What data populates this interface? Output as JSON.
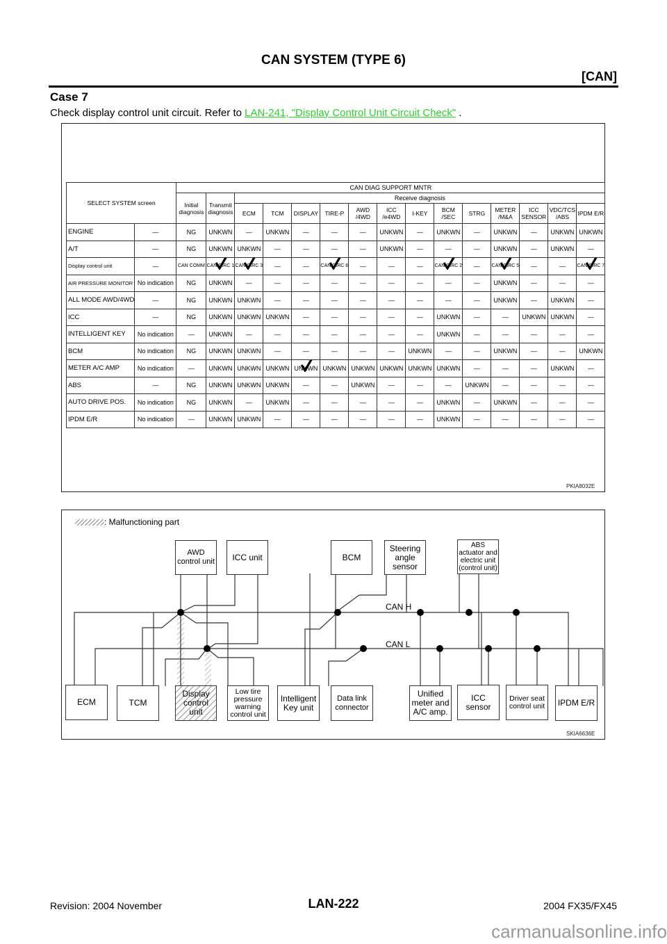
{
  "header": {
    "title": "CAN SYSTEM (TYPE 6)",
    "section": "[CAN]"
  },
  "case": {
    "title": "Case 7",
    "text": "Check display control unit circuit. Refer to ",
    "link": "LAN-241, \"Display Control Unit Circuit Check\"",
    "suffix": " ."
  },
  "table": {
    "select_header": "SELECT SYSTEM screen",
    "mntr_header": "CAN DIAG SUPPORT MNTR",
    "initial_header": "Initial diagnosis",
    "transmit_header": "Transmit diagnosis",
    "receive_header": "Receive diagnosis",
    "receive_columns": [
      "ECM",
      "TCM",
      "DISPLAY",
      "TIRE-P",
      "AWD /4WD",
      "ICC /e4WD",
      "I-KEY",
      "BCM /SEC",
      "STRG",
      "METER /M&A",
      "ICC SENSOR",
      "VDC/TCS /ABS",
      "IPDM E/R"
    ],
    "rows": [
      {
        "system": "ENGINE",
        "select": "—",
        "initial": "NG",
        "transmit": "UNKWN",
        "receive": [
          "—",
          "UNKWN",
          "—",
          "—",
          "—",
          "UNKWN",
          "—",
          "UNKWN",
          "—",
          "UNKWN",
          "—",
          "UNKWN",
          "UNKWN"
        ]
      },
      {
        "system": "A/T",
        "select": "—",
        "initial": "NG",
        "transmit": "UNKWN",
        "receive": [
          "UNKWN",
          "—",
          "—",
          "—",
          "—",
          "UNKWN",
          "—",
          "—",
          "—",
          "UNKWN",
          "—",
          "UNKWN",
          "—"
        ]
      },
      {
        "system": "Display control unit",
        "select": "—",
        "initial": "CAN COMM",
        "transmit": "CAN CIRC 1",
        "receive": [
          "CAN CIRC 3",
          "—",
          "—",
          "CAN CIRC 6",
          "—",
          "—",
          "—",
          "CAN CIRC 2",
          "—",
          "CAN CIRC 5",
          "—",
          "—",
          "CAN CIRC 7"
        ]
      },
      {
        "system": "AIR PRESSURE MONITOR",
        "select": "No indication",
        "initial": "NG",
        "transmit": "UNKWN",
        "receive": [
          "—",
          "—",
          "—",
          "—",
          "—",
          "—",
          "—",
          "—",
          "—",
          "UNKWN",
          "—",
          "—",
          "—"
        ]
      },
      {
        "system": "ALL MODE AWD/4WD",
        "select": "—",
        "initial": "NG",
        "transmit": "UNKWN",
        "receive": [
          "UNKWN",
          "—",
          "—",
          "—",
          "—",
          "—",
          "—",
          "—",
          "—",
          "UNKWN",
          "—",
          "UNKWN",
          "—"
        ]
      },
      {
        "system": "ICC",
        "select": "—",
        "initial": "NG",
        "transmit": "UNKWN",
        "receive": [
          "UNKWN",
          "UNKWN",
          "—",
          "—",
          "—",
          "—",
          "—",
          "UNKWN",
          "—",
          "—",
          "UNKWN",
          "UNKWN",
          "—"
        ]
      },
      {
        "system": "INTELLIGENT KEY",
        "select": "No indication",
        "initial": "—",
        "transmit": "UNKWN",
        "receive": [
          "—",
          "—",
          "—",
          "—",
          "—",
          "—",
          "—",
          "UNKWN",
          "—",
          "—",
          "—",
          "—",
          "—"
        ]
      },
      {
        "system": "BCM",
        "select": "No indication",
        "initial": "NG",
        "transmit": "UNKWN",
        "receive": [
          "UNKWN",
          "—",
          "—",
          "—",
          "—",
          "—",
          "UNKWN",
          "—",
          "—",
          "UNKWN",
          "—",
          "—",
          "UNKWN"
        ]
      },
      {
        "system": "METER A/C AMP",
        "select": "No indication",
        "initial": "—",
        "transmit": "UNKWN",
        "receive": [
          "UNKWN",
          "UNKWN",
          "UNKWN",
          "UNKWN",
          "UNKWN",
          "UNKWN",
          "UNKWN",
          "UNKWN",
          "—",
          "—",
          "—",
          "UNKWN",
          "—"
        ]
      },
      {
        "system": "ABS",
        "select": "—",
        "initial": "NG",
        "transmit": "UNKWN",
        "receive": [
          "UNKWN",
          "UNKWN",
          "—",
          "—",
          "UNKWN",
          "—",
          "—",
          "—",
          "UNKWN",
          "—",
          "—",
          "—",
          "—"
        ]
      },
      {
        "system": "AUTO DRIVE POS.",
        "select": "No indication",
        "initial": "NG",
        "transmit": "UNKWN",
        "receive": [
          "—",
          "UNKWN",
          "—",
          "—",
          "—",
          "—",
          "—",
          "UNKWN",
          "—",
          "UNKWN",
          "—",
          "—",
          "—"
        ]
      },
      {
        "system": "IPDM E/R",
        "select": "No indication",
        "initial": "—",
        "transmit": "UNKWN",
        "receive": [
          "UNKWN",
          "—",
          "—",
          "—",
          "—",
          "—",
          "—",
          "UNKWN",
          "—",
          "—",
          "—",
          "—",
          "—"
        ]
      }
    ],
    "checked_cells": [
      "2-transmit",
      "2-r0",
      "2-r3",
      "2-r7",
      "2-r9",
      "2-r12",
      "8-r2"
    ],
    "figure_id": "PKIA8032E"
  },
  "wiring": {
    "legend": ": Malfunctioning part",
    "can_h": "CAN H",
    "can_l": "CAN L",
    "top_units": [
      "AWD control unit",
      "ICC unit",
      "BCM",
      "Steering angle sensor",
      "ABS actuator and electric unit (control unit)"
    ],
    "bottom_units": [
      "ECM",
      "TCM",
      "Display control unit",
      "Low tire pressure warning control unit",
      "Intelligent Key unit",
      "Data link connector",
      "Unified meter and A/C amp.",
      "ICC sensor",
      "Driver seat control unit",
      "IPDM E/R"
    ],
    "malfunctioning": "Display control unit",
    "figure_id": "SKIA6636E"
  },
  "footer": {
    "revision": "Revision: 2004 November",
    "page": "LAN-222",
    "model": "2004 FX35/FX45",
    "watermark": "carmanualsonline.info"
  }
}
